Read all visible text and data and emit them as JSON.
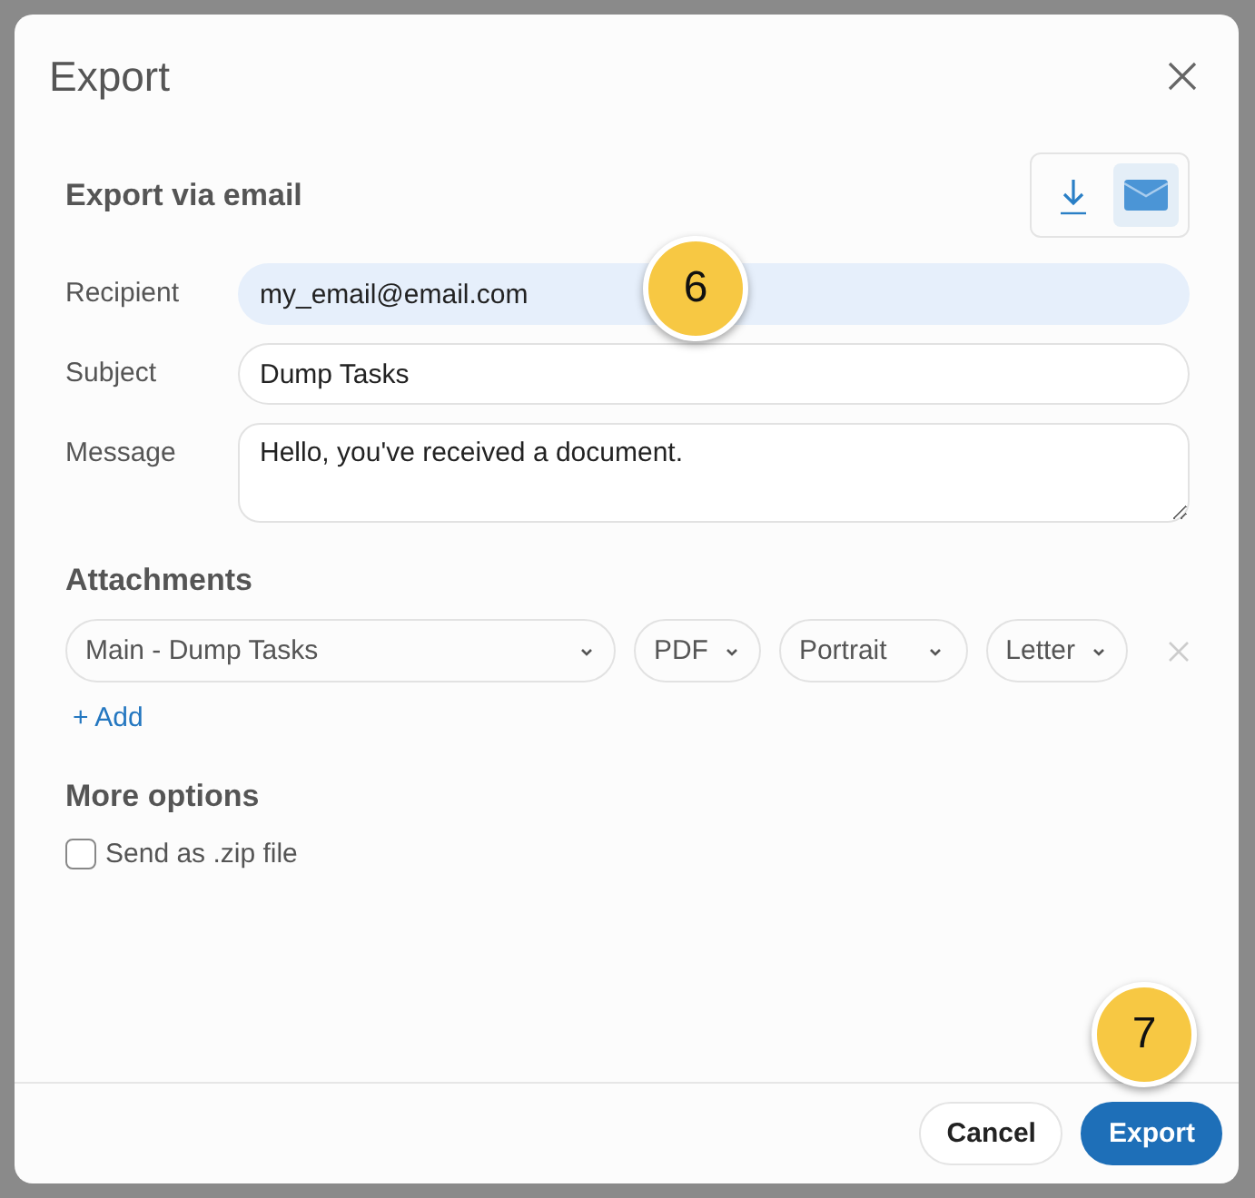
{
  "dialog": {
    "title": "Export",
    "section_title": "Export via email",
    "modes": [
      {
        "kind": "download",
        "selected": false
      },
      {
        "kind": "email",
        "selected": true
      }
    ],
    "fields": [
      {
        "kind": "input",
        "label": "Recipient",
        "value": "my_email@email.com",
        "focused": true
      },
      {
        "kind": "input",
        "label": "Subject",
        "value": "Dump Tasks",
        "focused": false
      },
      {
        "kind": "textarea",
        "label": "Message",
        "value": "Hello, you've received a document.",
        "focused": false
      }
    ],
    "attachments": {
      "title": "Attachments",
      "selects": [
        {
          "value": "Main - Dump Tasks"
        },
        {
          "value": "PDF"
        },
        {
          "value": "Portrait"
        },
        {
          "value": "Letter"
        }
      ],
      "add_label": "+ Add"
    },
    "more_options": {
      "title": "More options",
      "options": [
        {
          "label": "Send as .zip file",
          "checked": false
        }
      ]
    },
    "buttons": [
      {
        "kind": "secondary",
        "label": "Cancel"
      },
      {
        "kind": "primary",
        "label": "Export"
      }
    ]
  },
  "callouts": [
    {
      "number": "6"
    },
    {
      "number": "7"
    }
  ]
}
